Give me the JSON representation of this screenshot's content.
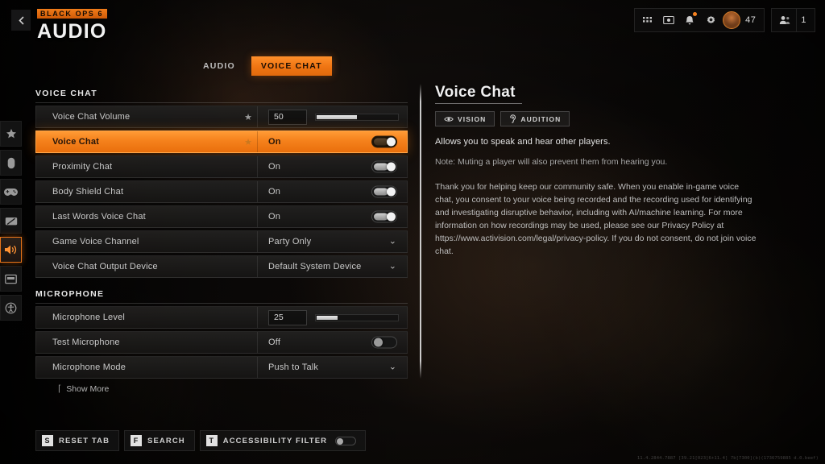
{
  "header": {
    "franchise_badge": "BLACK OPS 6",
    "page_title": "AUDIO",
    "back_icon": "chevron-left-icon"
  },
  "hud": {
    "apps_icon": "grid-apps-icon",
    "store_icon": "store-icon",
    "notifications_icon": "bell-icon",
    "settings_icon": "gear-icon",
    "avatar_icon": "player-avatar",
    "player_level": "47",
    "party_icon": "party-members-icon",
    "party_count": "1"
  },
  "tabs": [
    {
      "label": "AUDIO",
      "active": false
    },
    {
      "label": "VOICE CHAT",
      "active": true
    }
  ],
  "sidebar": {
    "items": [
      {
        "icon": "star-icon",
        "active": false
      },
      {
        "icon": "mouse-icon",
        "active": false
      },
      {
        "icon": "controller-icon",
        "active": false
      },
      {
        "icon": "graphics-icon",
        "active": false
      },
      {
        "icon": "speaker-icon",
        "active": true
      },
      {
        "icon": "interface-icon",
        "active": false
      },
      {
        "icon": "accessibility-icon",
        "active": false
      }
    ]
  },
  "settings": {
    "sections": [
      {
        "title": "VOICE CHAT",
        "rows": [
          {
            "label": "Voice Chat Volume",
            "star": true,
            "control": "slider",
            "value": "50",
            "fill_percent": 50,
            "selected": false
          },
          {
            "label": "Voice Chat",
            "star": true,
            "control": "toggle",
            "value": "On",
            "toggle_on": true,
            "selected": true
          },
          {
            "label": "Proximity Chat",
            "star": false,
            "control": "toggle",
            "value": "On",
            "toggle_on": true,
            "selected": false
          },
          {
            "label": "Body Shield Chat",
            "star": false,
            "control": "toggle",
            "value": "On",
            "toggle_on": true,
            "selected": false
          },
          {
            "label": "Last Words Voice Chat",
            "star": false,
            "control": "toggle",
            "value": "On",
            "toggle_on": true,
            "selected": false
          },
          {
            "label": "Game Voice Channel",
            "star": false,
            "control": "dropdown",
            "value": "Party Only",
            "selected": false
          },
          {
            "label": "Voice Chat Output Device",
            "star": false,
            "control": "dropdown",
            "value": "Default System Device",
            "selected": false
          }
        ]
      },
      {
        "title": "MICROPHONE",
        "rows": [
          {
            "label": "Microphone Level",
            "star": false,
            "control": "slider",
            "value": "25",
            "fill_percent": 25,
            "selected": false
          },
          {
            "label": "Test Microphone",
            "star": false,
            "control": "toggle",
            "value": "Off",
            "toggle_on": false,
            "selected": false
          },
          {
            "label": "Microphone Mode",
            "star": false,
            "control": "dropdown",
            "value": "Push to Talk",
            "selected": false
          }
        ]
      }
    ],
    "show_more": "Show More",
    "star_glyph": "★",
    "chevron_glyph": "⌄"
  },
  "info_panel": {
    "title": "Voice Chat",
    "tags": [
      {
        "label": "VISION",
        "icon": "eye-icon"
      },
      {
        "label": "AUDITION",
        "icon": "ear-icon"
      }
    ],
    "description": "Allows you to speak and hear other players.",
    "note": "Note: Muting a player will also prevent them from hearing you.",
    "legal": "Thank you for helping keep our community safe. When you enable in-game voice chat, you consent to your voice being recorded and the recording used for identifying and investigating disruptive behavior, including with AI/machine learning. For more information on how recordings may be used, please see our Privacy Policy at https://www.activision.com/legal/privacy-policy. If you do not consent, do not join voice chat."
  },
  "bottom_bar": {
    "buttons": [
      {
        "key": "S",
        "label": "RESET TAB",
        "has_toggle": false
      },
      {
        "key": "F",
        "label": "SEARCH",
        "has_toggle": false
      },
      {
        "key": "T",
        "label": "ACCESSIBILITY FILTER",
        "has_toggle": true
      }
    ]
  },
  "build_string": "11.4.2844.7887 [39.21[023]6+11.4] 7b[7300](b)(1736759885 d.0.beef)",
  "colors": {
    "accent": "#f5811c",
    "accent_light": "#ff9b35",
    "panel_bg": "#221f1e",
    "text_primary": "#e3e3e3",
    "text_muted": "#a6a6a6"
  }
}
